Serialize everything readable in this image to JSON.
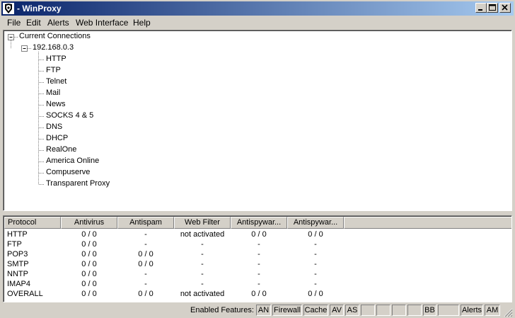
{
  "window": {
    "title": "- WinProxy",
    "icon": "winproxy-app-icon",
    "controls": [
      "minimize-icon",
      "maximize-icon",
      "close-icon"
    ]
  },
  "menu": [
    "File",
    "Edit",
    "Alerts",
    "Web Interface",
    "Help"
  ],
  "tree": {
    "root": "Current Connections",
    "host": "192.168.0.3",
    "items": [
      "HTTP",
      "FTP",
      "Telnet",
      "Mail",
      "News",
      "SOCKS 4 & 5",
      "DNS",
      "DHCP",
      "RealOne",
      "America Online",
      "Compuserve",
      "Transparent Proxy"
    ]
  },
  "table": {
    "columns": [
      "Protocol",
      "Antivirus",
      "Antispam",
      "Web Filter",
      "Antispywar...",
      "Antispywar..."
    ],
    "rows": [
      [
        "HTTP",
        "0 / 0",
        "-",
        "not activated",
        "0 / 0",
        "0 / 0"
      ],
      [
        "FTP",
        "0 / 0",
        "-",
        "-",
        "-",
        "-"
      ],
      [
        "POP3",
        "0 / 0",
        "0 / 0",
        "-",
        "-",
        "-"
      ],
      [
        "SMTP",
        "0 / 0",
        "0 / 0",
        "-",
        "-",
        "-"
      ],
      [
        "NNTP",
        "0 / 0",
        "-",
        "-",
        "-",
        "-"
      ],
      [
        "IMAP4",
        "0 / 0",
        "-",
        "-",
        "-",
        "-"
      ],
      [
        "OVERALL",
        "0 / 0",
        "0 / 0",
        "not activated",
        "0 / 0",
        "0 / 0"
      ]
    ]
  },
  "status": {
    "label": "Enabled Features:",
    "boxes": [
      "AN",
      "Firewall",
      "Cache",
      "AV",
      "AS",
      "",
      "",
      "",
      "",
      "BB",
      "",
      "Alerts",
      "AM"
    ]
  },
  "colors": {
    "titlebar_start": "#0a246a",
    "titlebar_end": "#a6caf0",
    "face": "#d4d0c8"
  }
}
